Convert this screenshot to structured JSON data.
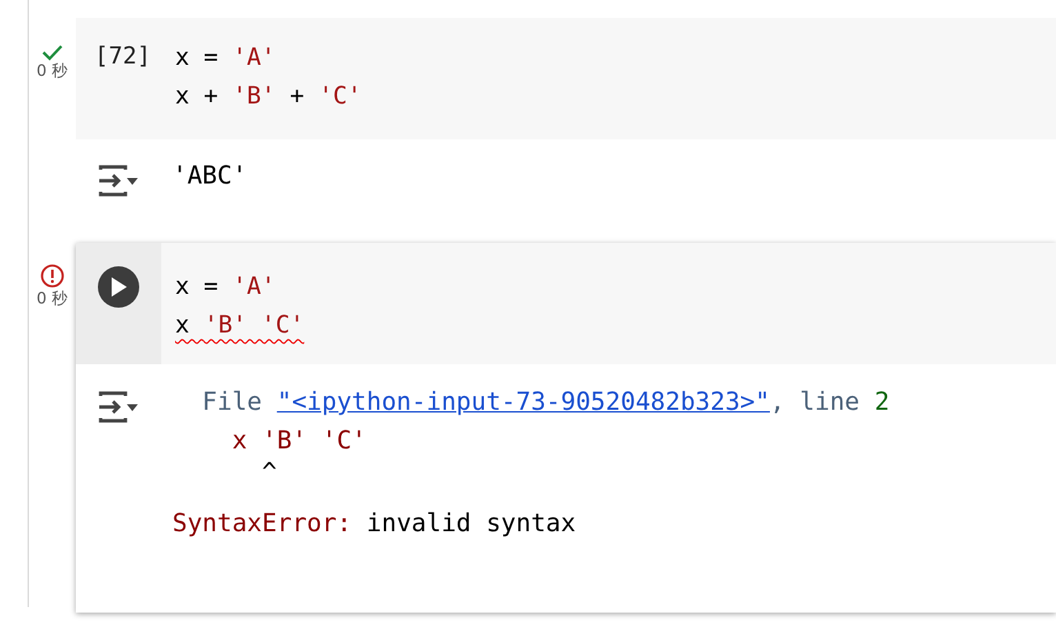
{
  "cells": [
    {
      "kind": "success",
      "exec_time": "0 秒",
      "prompt": "[72]",
      "focused": false,
      "code": [
        {
          "error": false,
          "tokens": [
            {
              "kind": "plain",
              "text": "x = "
            },
            {
              "kind": "string",
              "text": "'A'"
            }
          ]
        },
        {
          "error": false,
          "tokens": [
            {
              "kind": "plain",
              "text": "x + "
            },
            {
              "kind": "string",
              "text": "'B'"
            },
            {
              "kind": "plain",
              "text": " + "
            },
            {
              "kind": "string",
              "text": "'C'"
            }
          ]
        }
      ],
      "output": [
        {
          "tokens": [
            {
              "kind": "plain",
              "text": "'ABC'"
            }
          ]
        }
      ]
    },
    {
      "kind": "error",
      "exec_time": "0 秒",
      "focused": true,
      "code": [
        {
          "error": false,
          "tokens": [
            {
              "kind": "plain",
              "text": "x = "
            },
            {
              "kind": "string",
              "text": "'A'"
            }
          ]
        },
        {
          "error": true,
          "tokens": [
            {
              "kind": "plain",
              "text": "x "
            },
            {
              "kind": "string",
              "text": "'B' 'C'"
            }
          ]
        }
      ],
      "output": [
        {
          "tokens": [
            {
              "kind": "muted",
              "text": "  File "
            },
            {
              "kind": "link",
              "text": "\"<ipython-input-73-90520482b323>\""
            },
            {
              "kind": "muted",
              "text": ", line "
            },
            {
              "kind": "number",
              "text": "2"
            }
          ]
        },
        {
          "tokens": [
            {
              "kind": "error",
              "text": "    x 'B' 'C'"
            }
          ]
        },
        {
          "tokens": [
            {
              "kind": "plain",
              "text": "      ^"
            }
          ]
        },
        {
          "tokens": [
            {
              "kind": "error",
              "text": "SyntaxError: "
            },
            {
              "kind": "plain",
              "text": "invalid syntax"
            }
          ]
        }
      ]
    }
  ]
}
